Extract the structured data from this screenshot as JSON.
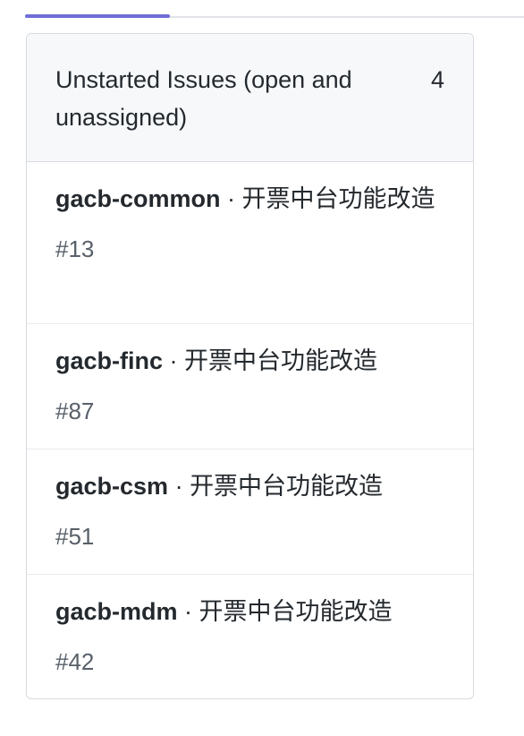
{
  "panel": {
    "title": "Unstarted Issues (open and unassigned)",
    "count": "4"
  },
  "separator": " · ",
  "issues": [
    {
      "repo": "gacb-common",
      "title": "开票中台功能改造",
      "number": "#13"
    },
    {
      "repo": "gacb-finc",
      "title": "开票中台功能改造",
      "number": "#87"
    },
    {
      "repo": "gacb-csm",
      "title": "开票中台功能改造",
      "number": "#51"
    },
    {
      "repo": "gacb-mdm",
      "title": "开票中台功能改造",
      "number": "#42"
    }
  ],
  "colors": {
    "accent": "#6f6fd8",
    "header_bg": "#f6f8fa",
    "border": "#d7dadf",
    "text": "#24292e",
    "muted": "#586069"
  }
}
